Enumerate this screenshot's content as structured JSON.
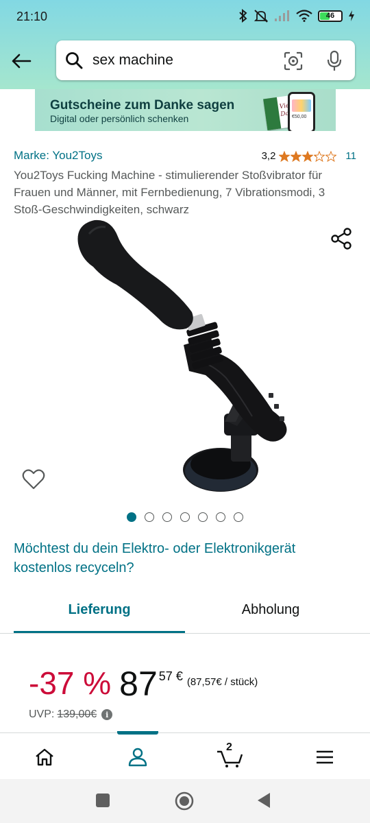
{
  "status_bar": {
    "time": "21:10",
    "battery": "46",
    "battery_level": 0.46,
    "icons": [
      "bluetooth-icon",
      "silent-icon",
      "signal-icon",
      "wifi-icon",
      "battery-icon",
      "charging-icon"
    ]
  },
  "search": {
    "query": "sex machine",
    "icons": [
      "back-arrow-icon",
      "search-icon",
      "camera-lens-icon",
      "microphone-icon"
    ]
  },
  "banner": {
    "title": "Gutscheine zum Danke sagen",
    "subtitle": "Digital oder persönlich schenken",
    "card_text": "Vielen Dank",
    "phone_price": "€50,00"
  },
  "product": {
    "brand": "Marke: You2Toys",
    "rating_value": "3,2",
    "rating_stars": 3.2,
    "rating_count": "11",
    "title": "You2Toys Fucking Machine - stimulierender Stoßvibrator für Frauen und Männer, mit Fernbedienung, 7 Vibrationsmodi, 3 Stoß-Geschwindigkeiten, schwarz",
    "image_count": 7,
    "active_image": 1
  },
  "recycle": {
    "text": "Möchtest du dein Elektro- oder Elektronikgerät kostenlos recyceln?"
  },
  "tabs": {
    "delivery": "Lieferung",
    "pickup": "Abholung",
    "active": "delivery"
  },
  "price": {
    "discount": "-37 %",
    "whole": "87",
    "fraction": "57 €",
    "unit_price": "(87,57€ / stück)",
    "uvp_label": "UVP:",
    "uvp_value": "139,00€",
    "info_icon": "i"
  },
  "bottom_nav": {
    "items": [
      "home-icon",
      "account-icon",
      "cart-icon",
      "menu-icon"
    ],
    "active": "account",
    "cart_count": "2"
  },
  "colors": {
    "accent": "#007185",
    "discount": "#cc0c39",
    "star": "#de7921",
    "header_top": "#82d8e3",
    "header_bottom": "#a5e6ce"
  }
}
